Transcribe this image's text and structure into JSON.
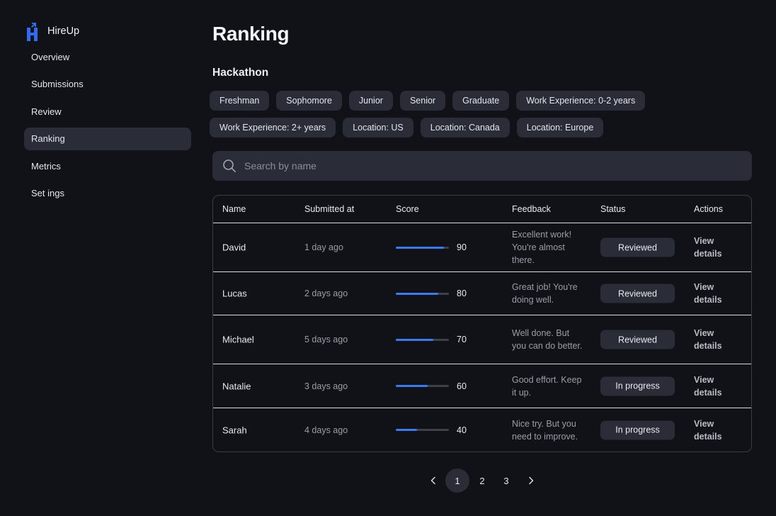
{
  "brand": {
    "name": "HireUp"
  },
  "sidebar": {
    "items": [
      {
        "label": "Overview"
      },
      {
        "label": "Submissions"
      },
      {
        "label": "Review"
      },
      {
        "label": "Ranking",
        "active": true
      },
      {
        "label": "Metrics"
      },
      {
        "label": "Set ings"
      }
    ]
  },
  "page": {
    "title": "Ranking",
    "section": "Hackathon"
  },
  "filters": {
    "row1": [
      "Freshman",
      "Sophomore",
      "Junior",
      "Senior",
      "Graduate",
      "Work Experience: 0-2 years"
    ],
    "row2": [
      "Work Experience: 2+ years",
      "Location: US",
      "Location: Canada",
      "Location: Europe"
    ]
  },
  "search": {
    "placeholder": "Search by name",
    "icon": "search-icon"
  },
  "table": {
    "headers": {
      "name": "Name",
      "submitted": "Submitted at",
      "score": "Score",
      "feedback": "Feedback",
      "status": "Status",
      "actions": "Actions"
    },
    "rows": [
      {
        "name": "David",
        "submitted": "1 day ago",
        "score": "90",
        "feedback": "Excellent work! You're almost there.",
        "status": "Reviewed",
        "action": "View details"
      },
      {
        "name": "Lucas",
        "submitted": "2 days ago",
        "score": "80",
        "feedback": "Great job! You're doing well.",
        "status": "Reviewed",
        "action": "View details"
      },
      {
        "name": "Michael",
        "submitted": "5 days ago",
        "score": "70",
        "feedback": "Well done. But you can do better.",
        "status": "Reviewed",
        "action": "View details"
      },
      {
        "name": "Natalie",
        "submitted": "3 days ago",
        "score": "60",
        "feedback": "Good effort. Keep it up.",
        "status": "In progress",
        "action": "View details"
      },
      {
        "name": "Sarah",
        "submitted": "4 days ago",
        "score": "40",
        "feedback": "Nice try. But you need to improve.",
        "status": "In progress",
        "action": "View details"
      }
    ]
  },
  "pagination": {
    "pages": [
      "1",
      "2",
      "3"
    ],
    "current": "1"
  },
  "colors": {
    "background": "#111218",
    "surface": "#2a2d38",
    "accent": "#3a7cf0"
  }
}
